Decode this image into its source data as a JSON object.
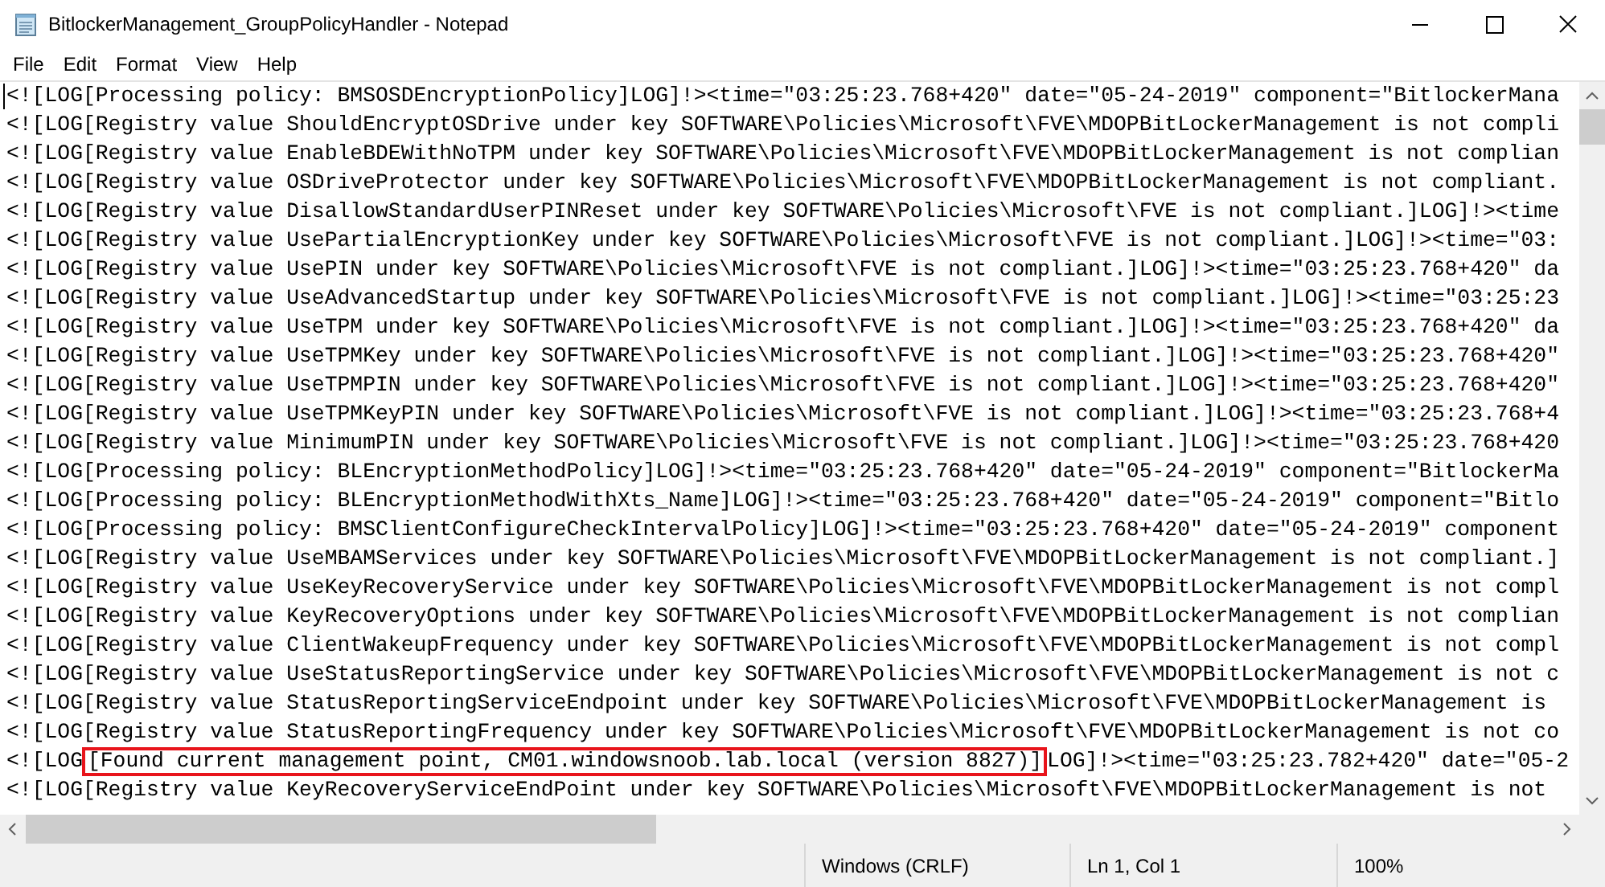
{
  "window": {
    "title": "BitlockerManagement_GroupPolicyHandler - Notepad"
  },
  "menu": [
    "File",
    "Edit",
    "Format",
    "View",
    "Help"
  ],
  "lines": [
    {
      "kind": "plain",
      "text": "<![LOG[Processing policy: BMSOSDEncryptionPolicy]LOG]!><time=\"03:25:23.768+420\" date=\"05-24-2019\" component=\"BitlockerMana"
    },
    {
      "kind": "plain",
      "text": "<![LOG[Registry value ShouldEncryptOSDrive under key SOFTWARE\\Policies\\Microsoft\\FVE\\MDOPBitLockerManagement is not compli"
    },
    {
      "kind": "plain",
      "text": "<![LOG[Registry value EnableBDEWithNoTPM under key SOFTWARE\\Policies\\Microsoft\\FVE\\MDOPBitLockerManagement is not complian"
    },
    {
      "kind": "plain",
      "text": "<![LOG[Registry value OSDriveProtector under key SOFTWARE\\Policies\\Microsoft\\FVE\\MDOPBitLockerManagement is not compliant."
    },
    {
      "kind": "plain",
      "text": "<![LOG[Registry value DisallowStandardUserPINReset under key SOFTWARE\\Policies\\Microsoft\\FVE is not compliant.]LOG]!><time"
    },
    {
      "kind": "plain",
      "text": "<![LOG[Registry value UsePartialEncryptionKey under key SOFTWARE\\Policies\\Microsoft\\FVE is not compliant.]LOG]!><time=\"03:"
    },
    {
      "kind": "plain",
      "text": "<![LOG[Registry value UsePIN under key SOFTWARE\\Policies\\Microsoft\\FVE is not compliant.]LOG]!><time=\"03:25:23.768+420\" da"
    },
    {
      "kind": "plain",
      "text": "<![LOG[Registry value UseAdvancedStartup under key SOFTWARE\\Policies\\Microsoft\\FVE is not compliant.]LOG]!><time=\"03:25:23"
    },
    {
      "kind": "plain",
      "text": "<![LOG[Registry value UseTPM under key SOFTWARE\\Policies\\Microsoft\\FVE is not compliant.]LOG]!><time=\"03:25:23.768+420\" da"
    },
    {
      "kind": "plain",
      "text": "<![LOG[Registry value UseTPMKey under key SOFTWARE\\Policies\\Microsoft\\FVE is not compliant.]LOG]!><time=\"03:25:23.768+420\""
    },
    {
      "kind": "plain",
      "text": "<![LOG[Registry value UseTPMPIN under key SOFTWARE\\Policies\\Microsoft\\FVE is not compliant.]LOG]!><time=\"03:25:23.768+420\""
    },
    {
      "kind": "plain",
      "text": "<![LOG[Registry value UseTPMKeyPIN under key SOFTWARE\\Policies\\Microsoft\\FVE is not compliant.]LOG]!><time=\"03:25:23.768+4"
    },
    {
      "kind": "plain",
      "text": "<![LOG[Registry value MinimumPIN under key SOFTWARE\\Policies\\Microsoft\\FVE is not compliant.]LOG]!><time=\"03:25:23.768+420"
    },
    {
      "kind": "plain",
      "text": "<![LOG[Processing policy: BLEncryptionMethodPolicy]LOG]!><time=\"03:25:23.768+420\" date=\"05-24-2019\" component=\"BitlockerMa"
    },
    {
      "kind": "plain",
      "text": "<![LOG[Processing policy: BLEncryptionMethodWithXts_Name]LOG]!><time=\"03:25:23.768+420\" date=\"05-24-2019\" component=\"Bitlo"
    },
    {
      "kind": "plain",
      "text": "<![LOG[Processing policy: BMSClientConfigureCheckIntervalPolicy]LOG]!><time=\"03:25:23.768+420\" date=\"05-24-2019\" component"
    },
    {
      "kind": "plain",
      "text": "<![LOG[Registry value UseMBAMServices under key SOFTWARE\\Policies\\Microsoft\\FVE\\MDOPBitLockerManagement is not compliant.]"
    },
    {
      "kind": "plain",
      "text": "<![LOG[Registry value UseKeyRecoveryService under key SOFTWARE\\Policies\\Microsoft\\FVE\\MDOPBitLockerManagement is not compl"
    },
    {
      "kind": "plain",
      "text": "<![LOG[Registry value KeyRecoveryOptions under key SOFTWARE\\Policies\\Microsoft\\FVE\\MDOPBitLockerManagement is not complian"
    },
    {
      "kind": "plain",
      "text": "<![LOG[Registry value ClientWakeupFrequency under key SOFTWARE\\Policies\\Microsoft\\FVE\\MDOPBitLockerManagement is not compl"
    },
    {
      "kind": "plain",
      "text": "<![LOG[Registry value UseStatusReportingService under key SOFTWARE\\Policies\\Microsoft\\FVE\\MDOPBitLockerManagement is not c"
    },
    {
      "kind": "plain",
      "text": "<![LOG[Registry value StatusReportingServiceEndpoint under key SOFTWARE\\Policies\\Microsoft\\FVE\\MDOPBitLockerManagement is"
    },
    {
      "kind": "plain",
      "text": "<![LOG[Registry value StatusReportingFrequency under key SOFTWARE\\Policies\\Microsoft\\FVE\\MDOPBitLockerManagement is not co"
    },
    {
      "kind": "highlighted",
      "before": "<![LOG",
      "marked": "[Found current management point, CM01.windowsnoob.lab.local (version 8827)]",
      "after": "LOG]!><time=\"03:25:23.782+420\" date=\"05-2"
    },
    {
      "kind": "plain",
      "text": "<![LOG[Registry value KeyRecoveryServiceEndPoint under key SOFTWARE\\Policies\\Microsoft\\FVE\\MDOPBitLockerManagement is not"
    }
  ],
  "status_bar": {
    "encoding": "Windows (CRLF)",
    "position": "Ln 1, Col 1",
    "zoom": "100%"
  }
}
